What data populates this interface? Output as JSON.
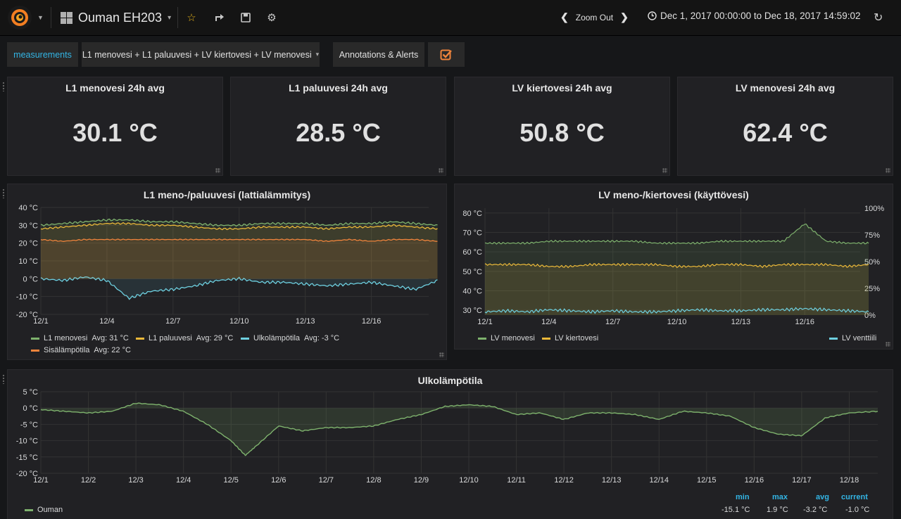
{
  "topbar": {
    "dashboard_title": "Ouman EH203",
    "title_caret": "▾",
    "zoom_out": "Zoom Out",
    "time_range": "Dec 1, 2017 00:00:00 to Dec 18, 2017 14:59:02",
    "icons": [
      "grafana-logo-icon",
      "star-icon",
      "share-icon",
      "save-icon",
      "gear-icon",
      "chevron-left-icon",
      "chevron-right-icon",
      "clock-icon",
      "refresh-icon"
    ]
  },
  "variables": {
    "label": "measurements",
    "value": "L1 menovesi + L1 paluuvesi + LV kiertovesi + LV menovesi",
    "caret": "▾",
    "annotations_label": "Annotations & Alerts",
    "annotations_enabled": true
  },
  "stats": [
    {
      "title": "L1 menovesi 24h avg",
      "value": "30.1 °C"
    },
    {
      "title": "L1 paluuvesi 24h avg",
      "value": "28.5 °C"
    },
    {
      "title": "LV kiertovesi 24h avg",
      "value": "50.8 °C"
    },
    {
      "title": "LV menovesi 24h avg",
      "value": "62.4 °C"
    }
  ],
  "colors": {
    "green": "#7eb26d",
    "yellow": "#eab839",
    "cyan": "#6ed0e0",
    "orange": "#ef843c",
    "accent_blue": "#33b5e5"
  },
  "panels": {
    "l1": {
      "title": "L1 meno-/paluuvesi (lattialämmitys)",
      "legend": [
        {
          "name": "L1 menovesi",
          "avg": "Avg: 31 °C"
        },
        {
          "name": "L1 paluuvesi",
          "avg": "Avg: 29 °C"
        },
        {
          "name": "Ulkolämpötila",
          "avg": "Avg: -3 °C"
        },
        {
          "name": "Sisälämpötila",
          "avg": "Avg: 22 °C"
        }
      ]
    },
    "lv": {
      "title": "LV meno-/kiertovesi (käyttövesi)",
      "legend": [
        {
          "name": "LV menovesi"
        },
        {
          "name": "LV kiertovesi"
        },
        {
          "name": "LV venttiili"
        }
      ]
    },
    "ulko": {
      "title": "Ulkolämpötila",
      "legend_headers": [
        "min",
        "max",
        "avg",
        "current"
      ],
      "legend_row": {
        "name": "Ouman",
        "min": "-15.1 °C",
        "max": "1.9 °C",
        "avg": "-3.2 °C",
        "current": "-1.0 °C"
      }
    }
  },
  "chart_data": [
    {
      "type": "line",
      "title": "L1 meno-/paluuvesi (lattialämmitys)",
      "x": [
        1,
        2,
        3,
        4,
        5,
        6,
        7,
        8,
        9,
        10,
        11,
        12,
        13,
        14,
        15,
        16,
        17,
        18,
        19
      ],
      "x_ticks": [
        "12/1",
        "12/4",
        "12/7",
        "12/10",
        "12/13",
        "12/16"
      ],
      "x_tick_days": [
        1,
        4,
        7,
        10,
        13,
        16
      ],
      "xlim": [
        1,
        18.6
      ],
      "y_ticks": [
        "-20 °C",
        "-10 °C",
        "0 °C",
        "10 °C",
        "20 °C",
        "30 °C",
        "40 °C"
      ],
      "ylim": [
        -20,
        40
      ],
      "series": [
        {
          "name": "L1 menovesi",
          "values": [
            30,
            31,
            32,
            33,
            33,
            32,
            32,
            31,
            30,
            30,
            31,
            31,
            31,
            30,
            31,
            31,
            32,
            31,
            30
          ]
        },
        {
          "name": "L1 paluuvesi",
          "values": [
            28,
            29,
            30,
            31,
            31,
            30,
            30,
            29,
            28,
            28,
            29,
            29,
            29,
            28,
            29,
            29,
            30,
            29,
            28
          ]
        },
        {
          "name": "Ulkolämpötila",
          "values": [
            0,
            -1,
            1,
            -1,
            -11,
            -7,
            -6,
            -4,
            -1,
            0,
            -2,
            -2,
            -3,
            -4,
            -3,
            -2,
            -4,
            -6,
            -1
          ]
        },
        {
          "name": "Sisälämpötila",
          "values": [
            22,
            21,
            22,
            22,
            22,
            22,
            22,
            22,
            22,
            22,
            22,
            22,
            22,
            21,
            22,
            21,
            22,
            22,
            21
          ]
        }
      ],
      "grid": true,
      "legend_position": "bottom"
    },
    {
      "type": "line",
      "title": "LV meno-/kiertovesi (käyttövesi)",
      "x": [
        1,
        2,
        3,
        4,
        5,
        6,
        7,
        8,
        9,
        10,
        11,
        12,
        13,
        14,
        15,
        16,
        17,
        18,
        19
      ],
      "x_ticks": [
        "12/1",
        "12/4",
        "12/7",
        "12/10",
        "12/13",
        "12/16"
      ],
      "x_tick_days": [
        1,
        4,
        7,
        10,
        13,
        16
      ],
      "xlim": [
        1,
        18.6
      ],
      "y_ticks": [
        "30 °C",
        "40 °C",
        "50 °C",
        "60 °C",
        "70 °C",
        "80 °C"
      ],
      "ylim": [
        25,
        80
      ],
      "y2_ticks": [
        "0%",
        "25%",
        "50%",
        "75%",
        "100%"
      ],
      "y2lim": [
        0,
        100
      ],
      "series": [
        {
          "name": "LV menovesi",
          "values": [
            62,
            62,
            62,
            63,
            63,
            63,
            63,
            63,
            62,
            62,
            62,
            63,
            63,
            63,
            63,
            72,
            63,
            62,
            62
          ]
        },
        {
          "name": "LV kiertovesi",
          "values": [
            51,
            51,
            51,
            50,
            50,
            51,
            51,
            51,
            51,
            50,
            50,
            51,
            51,
            50,
            51,
            51,
            51,
            50,
            51
          ]
        },
        {
          "name": "LV venttiili",
          "axis": "right",
          "values": [
            3,
            4,
            3,
            5,
            4,
            3,
            4,
            3,
            3,
            4,
            5,
            4,
            4,
            5,
            5,
            6,
            5,
            4,
            3
          ]
        }
      ],
      "grid": true,
      "legend_position": "bottom"
    },
    {
      "type": "area",
      "title": "Ulkolämpötila",
      "x": [
        1,
        1.5,
        2,
        2.5,
        3,
        3.5,
        4,
        4.5,
        5,
        5.3,
        5.5,
        6,
        6.5,
        7,
        7.5,
        8,
        8.5,
        9,
        9.5,
        10,
        10.5,
        11,
        11.5,
        12,
        12.5,
        13,
        13.5,
        14,
        14.5,
        15,
        15.5,
        16,
        16.5,
        17,
        17.5,
        18,
        18.6
      ],
      "x_ticks": [
        "12/1",
        "12/2",
        "12/3",
        "12/4",
        "12/5",
        "12/6",
        "12/7",
        "12/8",
        "12/9",
        "12/10",
        "12/11",
        "12/12",
        "12/13",
        "12/14",
        "12/15",
        "12/16",
        "12/17",
        "12/18"
      ],
      "x_tick_days": [
        1,
        2,
        3,
        4,
        5,
        6,
        7,
        8,
        9,
        10,
        11,
        12,
        13,
        14,
        15,
        16,
        17,
        18
      ],
      "xlim": [
        1,
        18.6
      ],
      "y_ticks": [
        "-20 °C",
        "-15 °C",
        "-10 °C",
        "-5 °C",
        "0 °C",
        "5 °C"
      ],
      "ylim": [
        -20,
        5
      ],
      "series": [
        {
          "name": "Ouman",
          "values": [
            -0.5,
            -1,
            -1.5,
            -1,
            1.5,
            1,
            -1,
            -5,
            -10,
            -14.5,
            -12,
            -5.5,
            -7,
            -6,
            -6,
            -5.5,
            -3.5,
            -2,
            0.5,
            1,
            0.5,
            -2,
            -1.5,
            -3.5,
            -1.5,
            -1.5,
            -2,
            -3.5,
            -1,
            -1.5,
            -2.5,
            -6,
            -8,
            -8.5,
            -3,
            -1.5,
            -1
          ]
        }
      ],
      "grid": true,
      "legend_position": "bottom"
    }
  ]
}
